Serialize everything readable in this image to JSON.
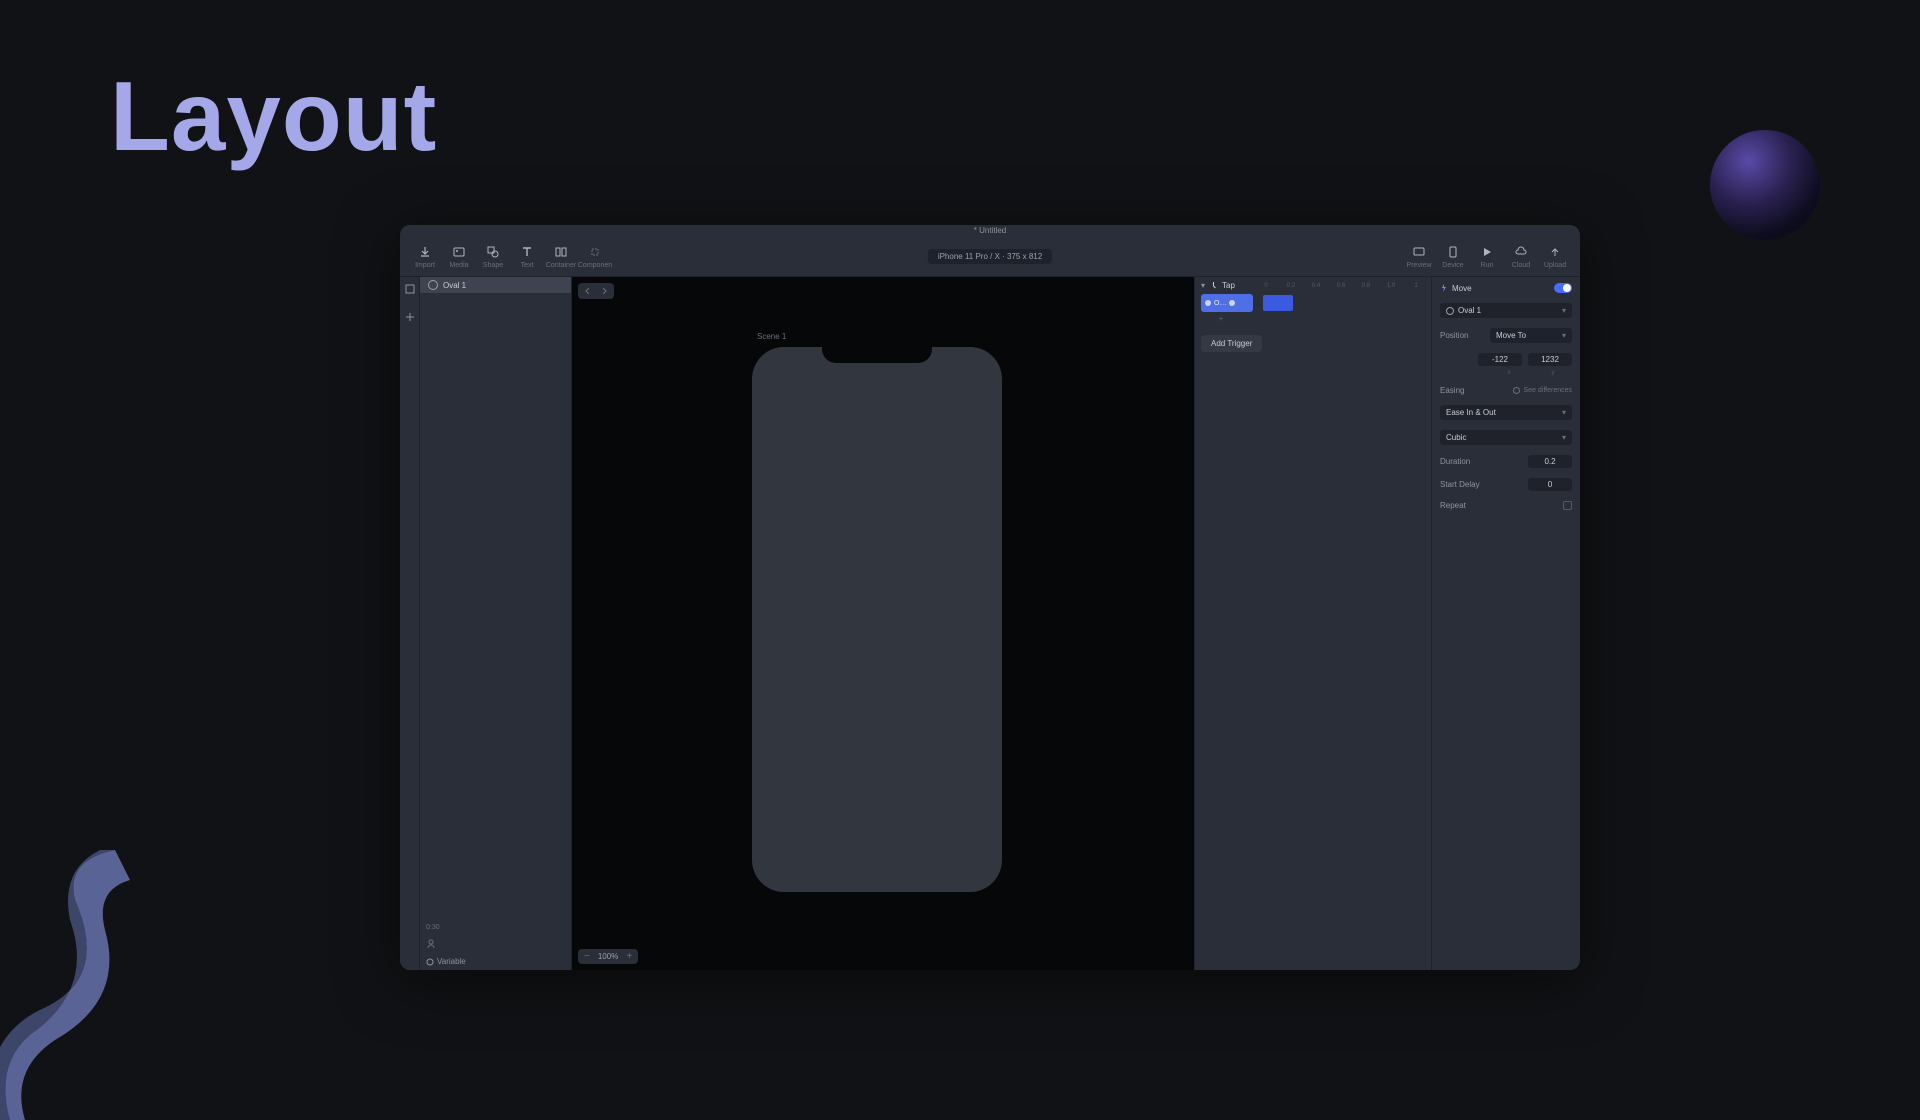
{
  "page": {
    "title": "Layout"
  },
  "window": {
    "doc_title": "* Untitled",
    "device_chip": "iPhone 11 Pro / X · 375 x 812"
  },
  "toolbar": {
    "left": [
      {
        "name": "import",
        "label": "Import"
      },
      {
        "name": "media",
        "label": "Media"
      },
      {
        "name": "shape",
        "label": "Shape"
      },
      {
        "name": "text",
        "label": "Text"
      },
      {
        "name": "container",
        "label": "Container"
      },
      {
        "name": "component",
        "label": "Componen"
      }
    ],
    "right": [
      {
        "name": "preview",
        "label": "Preview"
      },
      {
        "name": "devices",
        "label": "Device"
      },
      {
        "name": "run",
        "label": "Run"
      },
      {
        "name": "cloud",
        "label": "Cloud"
      },
      {
        "name": "upload",
        "label": "Upload"
      }
    ]
  },
  "layers": {
    "items": [
      {
        "label": "Oval 1",
        "selected": true
      }
    ],
    "footer": {
      "zoom_mini": "0:30",
      "variable_label": "Variable"
    }
  },
  "canvas": {
    "scene_label": "Scene 1",
    "zoom": "100%"
  },
  "timeline": {
    "trigger_label": "Tap",
    "marks": [
      "0",
      "0.2",
      "0.4",
      "0.6",
      "0.8",
      "1.0",
      "1"
    ],
    "object_label": "O…",
    "add_trigger": "Add Trigger"
  },
  "inspector": {
    "action_title": "Move",
    "target_label": "Oval 1",
    "position": {
      "label": "Position",
      "mode": "Move To",
      "x": "-122",
      "y": "1232",
      "x_axis": "x",
      "y_axis": "y"
    },
    "easing": {
      "label": "Easing",
      "diff_link": "See differences",
      "curve": "Ease In & Out",
      "style": "Cubic"
    },
    "duration": {
      "label": "Duration",
      "value": "0.2"
    },
    "delay": {
      "label": "Start Delay",
      "value": "0"
    },
    "repeat": {
      "label": "Repeat"
    }
  }
}
